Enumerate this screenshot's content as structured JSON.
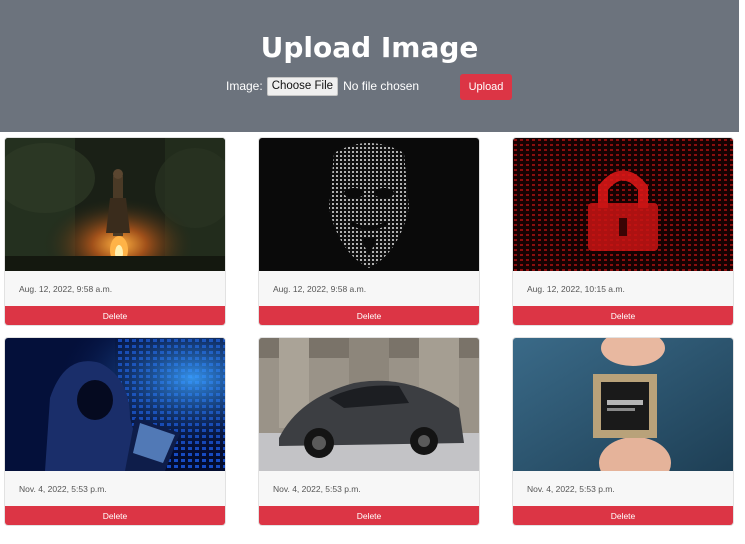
{
  "header": {
    "title": "Upload Image",
    "image_label": "Image:",
    "choose_file_label": "Choose File",
    "no_file_text": "No file chosen",
    "upload_label": "Upload"
  },
  "colors": {
    "header_bg": "#6c737d",
    "danger": "#dc3545"
  },
  "cards": [
    {
      "date": "Aug. 12, 2022, 9:58 a.m.",
      "delete_label": "Delete",
      "image": "dark-fantasy-knight-bonfire"
    },
    {
      "date": "Aug. 12, 2022, 9:58 a.m.",
      "delete_label": "Delete",
      "image": "anonymous-mask-ascii"
    },
    {
      "date": "Aug. 12, 2022, 10:15 a.m.",
      "delete_label": "Delete",
      "image": "red-padlock-binary"
    },
    {
      "date": "Nov. 4, 2022, 5:53 p.m.",
      "delete_label": "Delete",
      "image": "hooded-hacker-laptop"
    },
    {
      "date": "Nov. 4, 2022, 5:53 p.m.",
      "delete_label": "Delete",
      "image": "grey-sports-car"
    },
    {
      "date": "Nov. 4, 2022, 5:53 p.m.",
      "delete_label": "Delete",
      "image": "chip-between-fingers"
    }
  ]
}
